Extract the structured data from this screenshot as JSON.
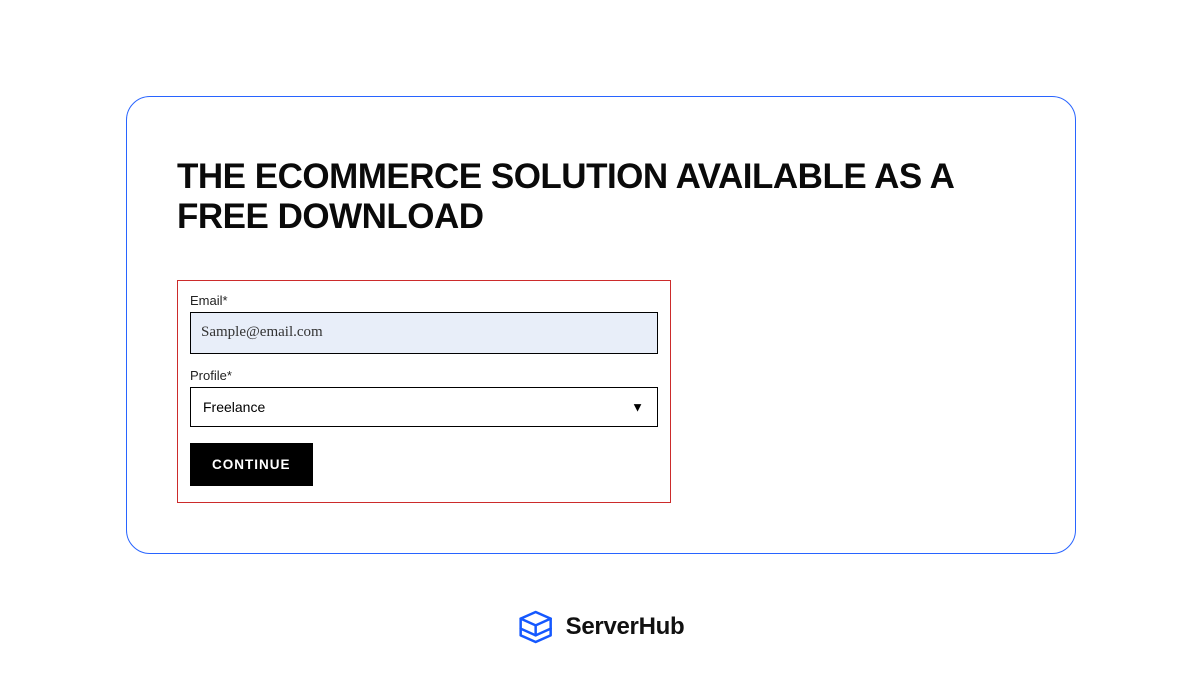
{
  "heading": "THE ECOMMERCE SOLUTION AVAILABLE AS A FREE DOWNLOAD",
  "form": {
    "email_label": "Email*",
    "email_value": "Sample@email.com",
    "profile_label": "Profile*",
    "profile_value": "Freelance",
    "continue_label": "CONTINUE"
  },
  "footer": {
    "brand": "ServerHub"
  }
}
